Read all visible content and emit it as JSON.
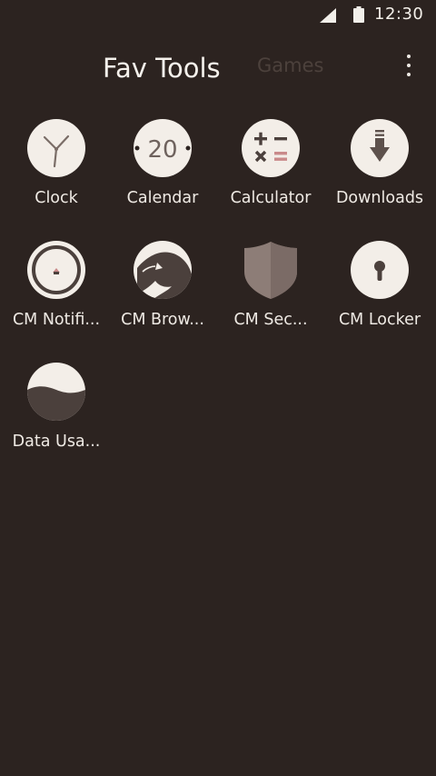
{
  "status_bar": {
    "time": "12:30"
  },
  "tabs": [
    {
      "label": "Fav Tools",
      "selected": true
    },
    {
      "label": "Games",
      "selected": false
    }
  ],
  "apps": [
    {
      "name": "Clock",
      "icon": "clock-icon"
    },
    {
      "name": "Calendar",
      "icon": "calendar-icon",
      "icon_text": "20"
    },
    {
      "name": "Calculator",
      "icon": "calculator-icon"
    },
    {
      "name": "Downloads",
      "icon": "download-icon"
    },
    {
      "name": "CM Notifi...",
      "icon": "notification-icon"
    },
    {
      "name": "CM Brow...",
      "icon": "panther-icon"
    },
    {
      "name": "CM Sec...",
      "icon": "shield-icon"
    },
    {
      "name": "CM Locker",
      "icon": "keyhole-icon"
    },
    {
      "name": "Data Usa...",
      "icon": "data-usage-icon"
    }
  ],
  "colors": {
    "background": "#2c2320",
    "icon_background": "#f3eee8",
    "icon_dark": "#4b403c",
    "accent_pink": "#c98a8a"
  }
}
